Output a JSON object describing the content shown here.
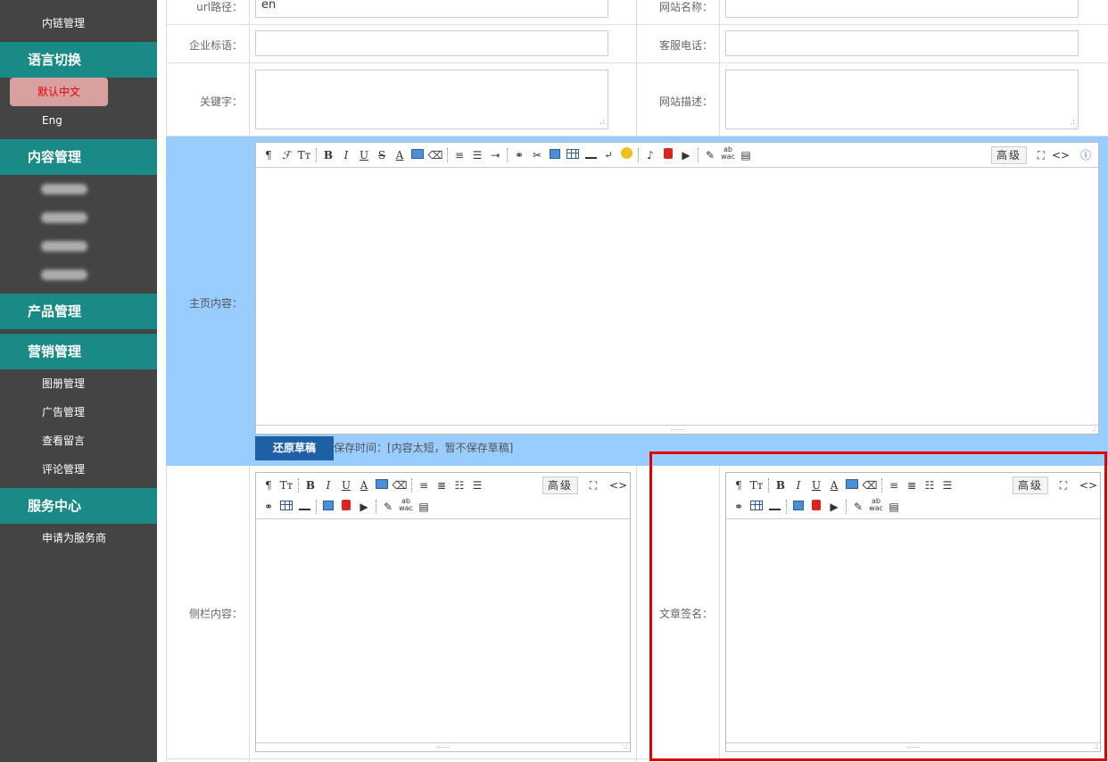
{
  "sidebar": {
    "link_management": "内链管理",
    "language_section": "语言切换",
    "language_default": "默认中文",
    "language_en": "Eng",
    "content_section": "内容管理",
    "product_section": "产品管理",
    "marketing_section": "营销管理",
    "marketing_items": [
      "图册管理",
      "广告管理",
      "查看留言",
      "评论管理"
    ],
    "service_section": "服务中心",
    "service_items": [
      "申请为服务商"
    ]
  },
  "form": {
    "url_label": "url路径：",
    "url_value": "en",
    "site_name_label": "网站名称：",
    "slogan_label": "企业标语：",
    "service_phone_label": "客服电话：",
    "keywords_label": "关键字：",
    "site_desc_label": "网站描述：",
    "home_content_label": "主页内容：",
    "sidebar_content_label": "侧栏内容：",
    "article_sign_label": "文章签名：",
    "restore_draft": "还原草稿",
    "save_time": "保存时间：[内容太短，暂不保存草稿]",
    "advanced": "高级"
  },
  "colors": {
    "sidebar_bg": "#444444",
    "section_bg": "#1a8a86",
    "active_bg": "#d9a0a0",
    "active_text": "#e60000",
    "home_row_bg": "#99ccff",
    "restore_btn": "#1e5fa6",
    "highlight": "#e00000"
  }
}
